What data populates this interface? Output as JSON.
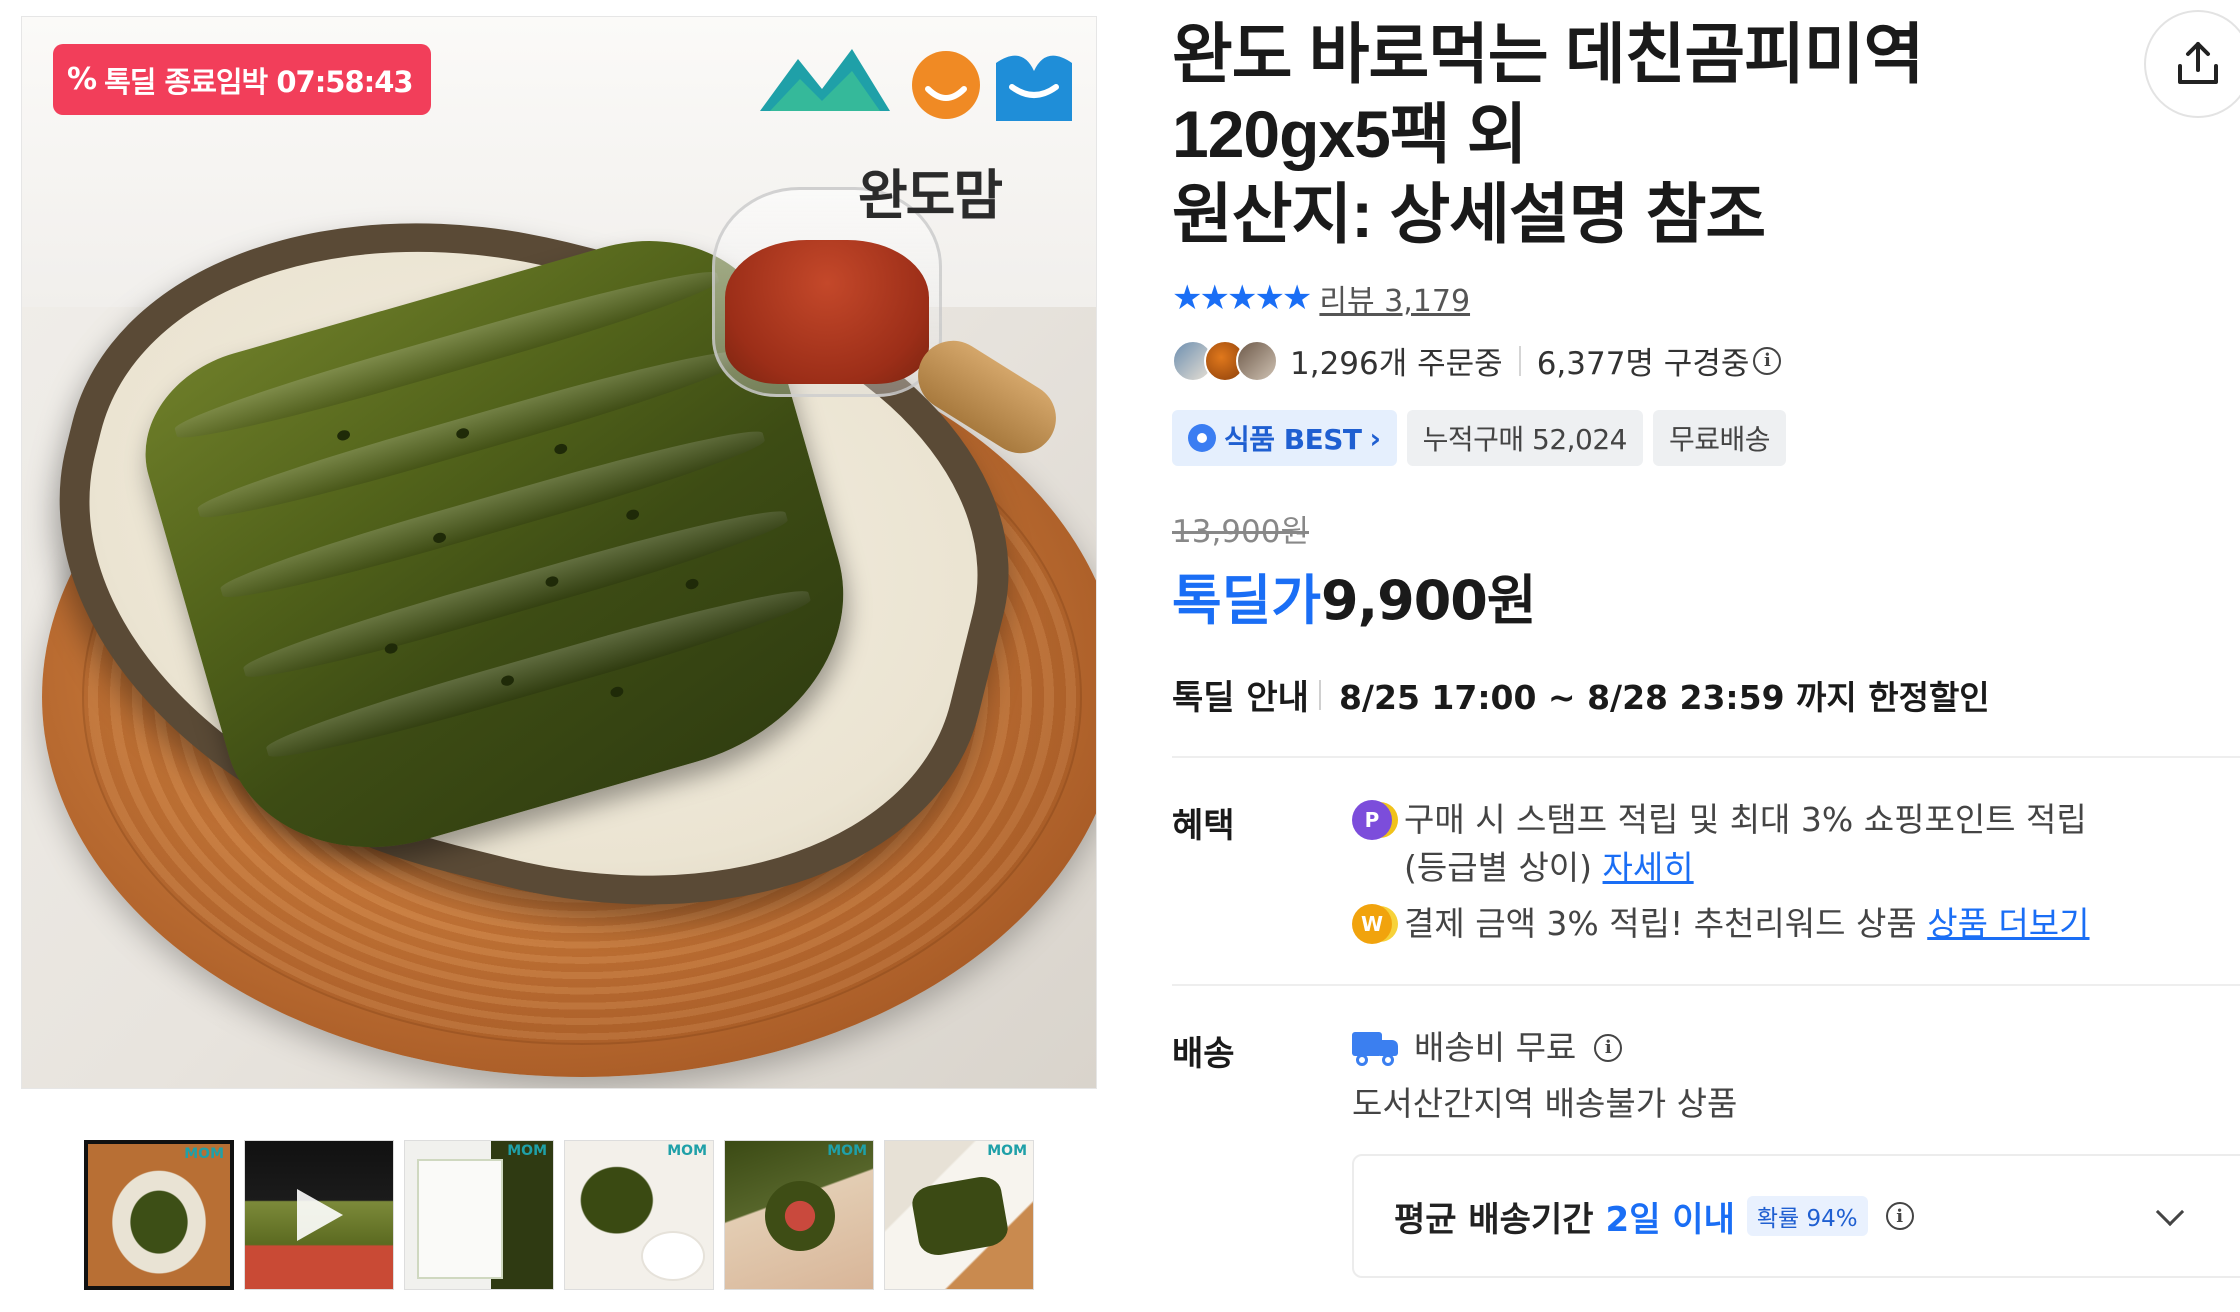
{
  "promo": {
    "badge_icon": "%",
    "badge_text": "톡딜 종료임박 07:58:43",
    "badge_color": "#f23e5a"
  },
  "brand": {
    "logo_text": "MOM",
    "logo_subtitle": "완도맘"
  },
  "thumbnails": [
    {
      "name": "thumb-1",
      "active": true
    },
    {
      "name": "thumb-2-video",
      "active": false
    },
    {
      "name": "thumb-3",
      "active": false
    },
    {
      "name": "thumb-4",
      "active": false
    },
    {
      "name": "thumb-5",
      "active": false
    },
    {
      "name": "thumb-6",
      "active": false
    }
  ],
  "product": {
    "title_lines": [
      "완도 바로먹는 데친곰피미역",
      "120gx5팩 외",
      "원산지: 상세설명 참조"
    ],
    "share_icon": "share-icon"
  },
  "rating": {
    "stars": "★★★★★",
    "review_label": "리뷰 3,179"
  },
  "social": {
    "ordering": "1,296개 주문중",
    "viewing": "6,377명 구경중"
  },
  "tags": [
    {
      "label": "식품 BEST",
      "suffix": "›"
    },
    {
      "label": "누적구매 52,024"
    },
    {
      "label": "무료배송"
    }
  ],
  "price": {
    "original": "13,900원",
    "label": "톡딜가",
    "value": "9,900원",
    "accent_color": "#1a6ef5"
  },
  "deal": {
    "label": "톡딜 안내",
    "period": "8/25 17:00 ~ 8/28 23:59 까지 한정할인"
  },
  "benefits": {
    "title": "혜택",
    "items": [
      {
        "icon": "P",
        "line1": "구매 시 스탬프 적립 및 최대 3% 쇼핑포인트 적립",
        "line2": "(등급별 상이)",
        "link": "자세히"
      },
      {
        "icon": "W",
        "line1": "결제 금액 3% 적립! 추천리워드 상품",
        "link": "상품 더보기"
      }
    ]
  },
  "shipping": {
    "title": "배송",
    "fee": "배송비 무료",
    "note": "도서산간지역 배송불가 상품",
    "avg_label": "평균 배송기간",
    "avg_value": "2일 이내",
    "probability": "확률 94%"
  }
}
